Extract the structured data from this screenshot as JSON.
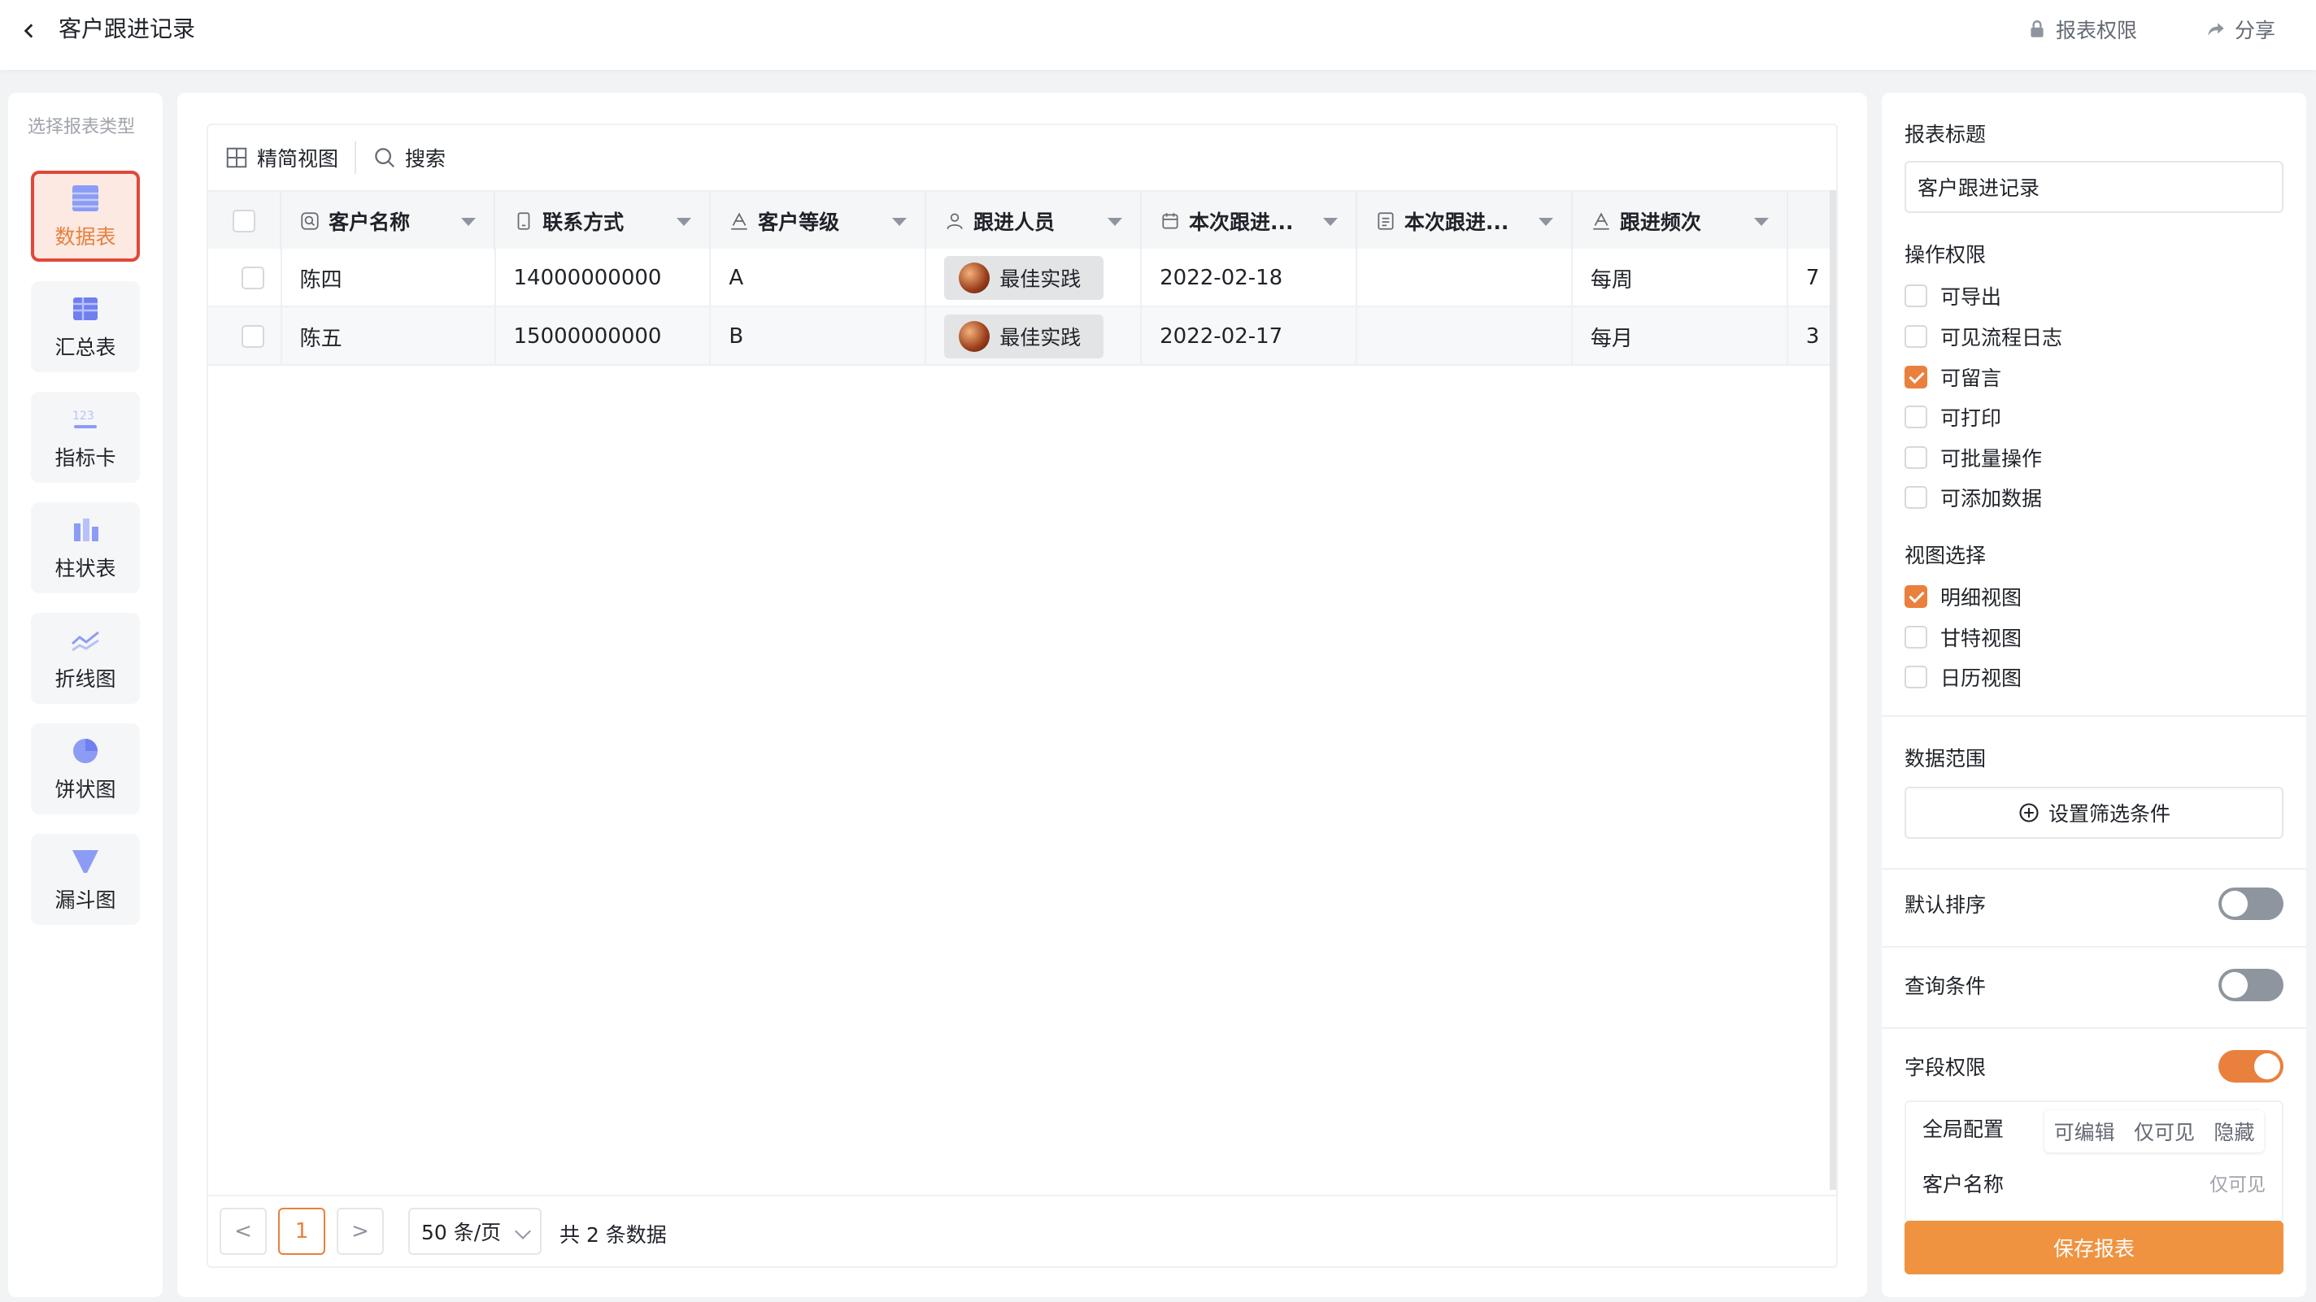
{
  "header": {
    "title": "客户跟进记录",
    "report_permission": "报表权限",
    "share": "分享"
  },
  "left_panel": {
    "label": "选择报表类型",
    "types": [
      {
        "label": "数据表",
        "icon": "table-icon",
        "active": true
      },
      {
        "label": "汇总表",
        "icon": "summary-table-icon",
        "active": false
      },
      {
        "label": "指标卡",
        "icon": "metric-card-icon",
        "active": false
      },
      {
        "label": "柱状表",
        "icon": "bar-chart-icon",
        "active": false
      },
      {
        "label": "折线图",
        "icon": "line-chart-icon",
        "active": false
      },
      {
        "label": "饼状图",
        "icon": "pie-chart-icon",
        "active": false
      },
      {
        "label": "漏斗图",
        "icon": "funnel-chart-icon",
        "active": false
      }
    ]
  },
  "toolbar": {
    "compact_view": "精简视图",
    "search": "搜索"
  },
  "table": {
    "columns": [
      {
        "label": "客户名称",
        "icon": "search-field-icon"
      },
      {
        "label": "联系方式",
        "icon": "phone-field-icon"
      },
      {
        "label": "客户等级",
        "icon": "text-field-icon"
      },
      {
        "label": "跟进人员",
        "icon": "person-field-icon"
      },
      {
        "label": "本次跟进...",
        "icon": "date-field-icon"
      },
      {
        "label": "本次跟进...",
        "icon": "text-area-field-icon"
      },
      {
        "label": "跟进频次",
        "icon": "text-field-icon"
      }
    ],
    "rows": [
      {
        "name": "陈四",
        "phone": "14000000000",
        "level": "A",
        "person": "最佳实践",
        "date": "2022-02-18",
        "content": "",
        "frequency": "每周",
        "extra": "7"
      },
      {
        "name": "陈五",
        "phone": "15000000000",
        "level": "B",
        "person": "最佳实践",
        "date": "2022-02-17",
        "content": "",
        "frequency": "每月",
        "extra": "3"
      }
    ]
  },
  "pagination": {
    "prev": "<",
    "current_page": "1",
    "next": ">",
    "page_size": "50 条/页",
    "total": "共 2 条数据"
  },
  "right_panel": {
    "report_title_label": "报表标题",
    "report_title_value": "客户跟进记录",
    "operation_permission_label": "操作权限",
    "permissions": [
      {
        "label": "可导出",
        "checked": false
      },
      {
        "label": "可见流程日志",
        "checked": false
      },
      {
        "label": "可留言",
        "checked": true
      },
      {
        "label": "可打印",
        "checked": false
      },
      {
        "label": "可批量操作",
        "checked": false
      },
      {
        "label": "可添加数据",
        "checked": false
      }
    ],
    "view_selection_label": "视图选择",
    "views": [
      {
        "label": "明细视图",
        "checked": true
      },
      {
        "label": "甘特视图",
        "checked": false
      },
      {
        "label": "日历视图",
        "checked": false
      }
    ],
    "data_range_label": "数据范围",
    "set_filter": "设置筛选条件",
    "default_sort_label": "默认排序",
    "default_sort_on": false,
    "query_condition_label": "查询条件",
    "query_condition_on": false,
    "field_permission_label": "字段权限",
    "field_permission_on": true,
    "global_config_label": "全局配置",
    "seg_options": [
      "可编辑",
      "仅可见",
      "隐藏"
    ],
    "field_name": "客户名称",
    "field_visibility": "仅可见",
    "save_button": "保存报表"
  },
  "colors": {
    "accent": "#e9803d",
    "active_border": "#e0483a",
    "save_button": "#ef9340"
  }
}
